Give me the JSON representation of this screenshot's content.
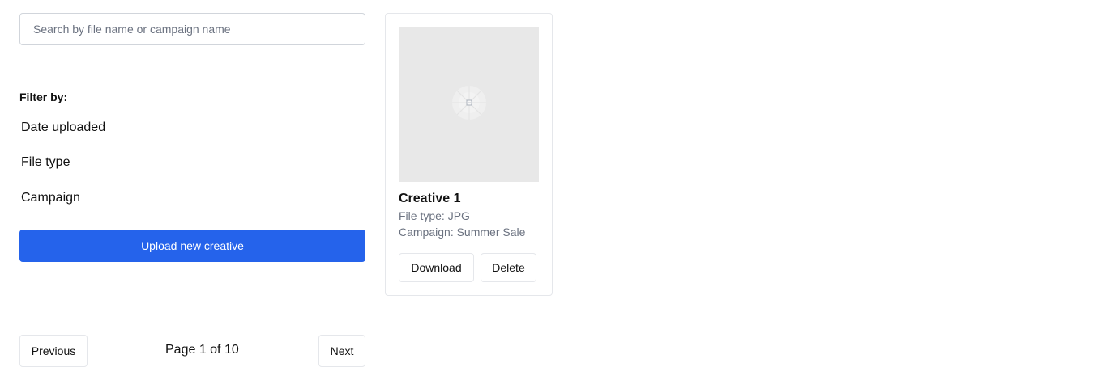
{
  "search": {
    "placeholder": "Search by file name or campaign name",
    "value": ""
  },
  "filters": {
    "heading": "Filter by:",
    "items": [
      {
        "label": "Date uploaded"
      },
      {
        "label": "File type"
      },
      {
        "label": "Campaign"
      }
    ]
  },
  "upload": {
    "label": "Upload new creative"
  },
  "pagination": {
    "previous_label": "Previous",
    "indicator": "Page 1 of 10",
    "next_label": "Next"
  },
  "creatives": [
    {
      "title": "Creative 1",
      "file_type": "File type: JPG",
      "campaign": "Campaign: Summer Sale",
      "image_icon": "image-placeholder-icon",
      "download_label": "Download",
      "delete_label": "Delete"
    }
  ],
  "colors": {
    "primary": "#2563eb",
    "border": "#e5e7eb",
    "muted_text": "#6b7280",
    "image_placeholder": "#e8e8e8"
  }
}
